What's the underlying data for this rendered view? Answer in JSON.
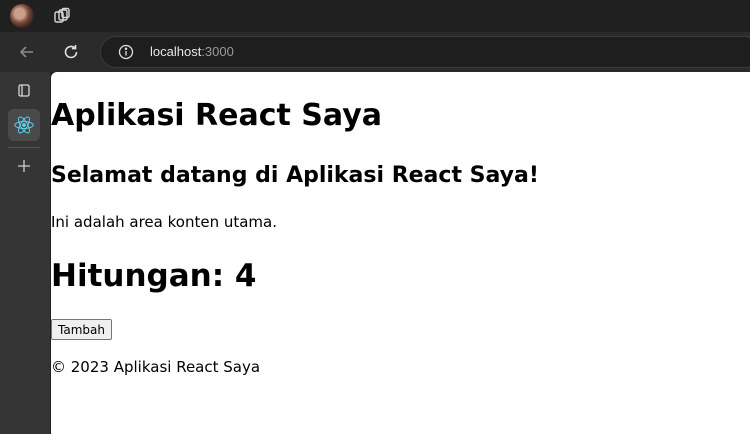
{
  "browser": {
    "address": {
      "host": "localhost",
      "port": ":3000"
    }
  },
  "page": {
    "title": "Aplikasi React Saya",
    "welcome": "Selamat datang di Aplikasi React Saya!",
    "content_text": "Ini adalah area konten utama.",
    "counter_text": "Hitungan: 4",
    "button_label": "Tambah",
    "footer_text": "© 2023 Aplikasi React Saya"
  },
  "icons": {
    "profile": "avatar",
    "workspaces": "workspaces-icon",
    "back": "back-arrow-icon",
    "reload": "reload-icon",
    "info": "info-icon",
    "tabs": "tab-actions-icon",
    "react_tab": "react-logo-icon",
    "new_tab": "plus-icon"
  },
  "colors": {
    "chrome_dark": "#202020",
    "toolbar": "#2b2b2b",
    "sidebar": "#353535",
    "react": "#61dafb"
  }
}
